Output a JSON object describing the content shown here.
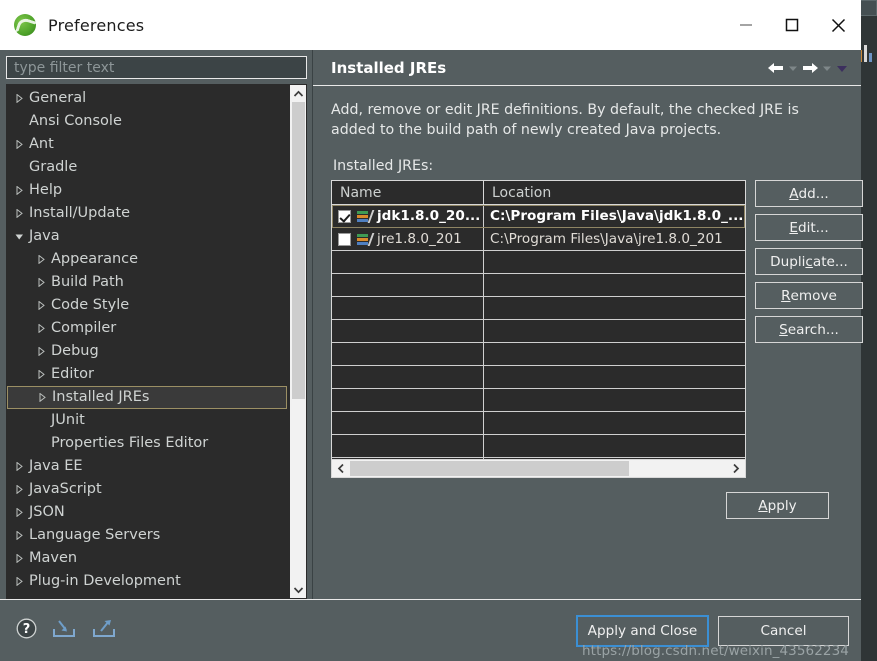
{
  "window": {
    "title": "Preferences",
    "app_icon": "eclipse-logo-icon",
    "controls": {
      "minimize": "minimize-icon",
      "maximize": "maximize-icon",
      "close": "close-icon"
    }
  },
  "sidebar": {
    "filter": {
      "placeholder": "type filter text",
      "value": ""
    },
    "items": [
      {
        "label": "General",
        "level": 1,
        "arrow": "collapsed"
      },
      {
        "label": "Ansi Console",
        "level": 1,
        "arrow": "none"
      },
      {
        "label": "Ant",
        "level": 1,
        "arrow": "collapsed"
      },
      {
        "label": "Gradle",
        "level": 1,
        "arrow": "none"
      },
      {
        "label": "Help",
        "level": 1,
        "arrow": "collapsed"
      },
      {
        "label": "Install/Update",
        "level": 1,
        "arrow": "collapsed"
      },
      {
        "label": "Java",
        "level": 1,
        "arrow": "expanded"
      },
      {
        "label": "Appearance",
        "level": 2,
        "arrow": "collapsed"
      },
      {
        "label": "Build Path",
        "level": 2,
        "arrow": "collapsed"
      },
      {
        "label": "Code Style",
        "level": 2,
        "arrow": "collapsed"
      },
      {
        "label": "Compiler",
        "level": 2,
        "arrow": "collapsed"
      },
      {
        "label": "Debug",
        "level": 2,
        "arrow": "collapsed"
      },
      {
        "label": "Editor",
        "level": 2,
        "arrow": "collapsed"
      },
      {
        "label": "Installed JREs",
        "level": 2,
        "arrow": "collapsed",
        "selected": true
      },
      {
        "label": "JUnit",
        "level": 2,
        "arrow": "none"
      },
      {
        "label": "Properties Files Editor",
        "level": 2,
        "arrow": "none"
      },
      {
        "label": "Java EE",
        "level": 1,
        "arrow": "collapsed"
      },
      {
        "label": "JavaScript",
        "level": 1,
        "arrow": "collapsed"
      },
      {
        "label": "JSON",
        "level": 1,
        "arrow": "collapsed"
      },
      {
        "label": "Language Servers",
        "level": 1,
        "arrow": "collapsed"
      },
      {
        "label": "Maven",
        "level": 1,
        "arrow": "collapsed"
      },
      {
        "label": "Plug-in Development",
        "level": 1,
        "arrow": "collapsed"
      }
    ]
  },
  "panel": {
    "title": "Installed JREs",
    "nav": {
      "back": "back-arrow-icon",
      "forward": "forward-arrow-icon",
      "menu": "chevron-down-icon"
    },
    "description": "Add, remove or edit JRE definitions. By default, the checked JRE is added to the build path of newly created Java projects.",
    "list_label": "Installed JREs:",
    "table": {
      "columns": [
        "Name",
        "Location"
      ],
      "rows": [
        {
          "checked": true,
          "selected": true,
          "name": "jdk1.8.0_20...",
          "location": "C:\\Program Files\\Java\\jdk1.8.0_..."
        },
        {
          "checked": false,
          "selected": false,
          "name": "jre1.8.0_201",
          "location": "C:\\Program Files\\Java\\jre1.8.0_201"
        }
      ],
      "empty_row_count": 10
    },
    "buttons": [
      {
        "label": "Add...",
        "mnemonic": "A"
      },
      {
        "label": "Edit...",
        "mnemonic": "E"
      },
      {
        "label": "Duplicate...",
        "mnemonic": "c"
      },
      {
        "label": "Remove",
        "mnemonic": "R"
      },
      {
        "label": "Search...",
        "mnemonic": "S"
      }
    ],
    "apply": {
      "label": "Apply",
      "mnemonic": "A"
    }
  },
  "footer": {
    "icons": [
      {
        "name": "help-icon"
      },
      {
        "name": "import-icon"
      },
      {
        "name": "export-icon"
      }
    ],
    "apply_and_close": "Apply and Close",
    "cancel": "Cancel",
    "watermark": "https://blog.csdn.net/weixin_43562234"
  },
  "colors": {
    "dialog_bg": "#555e60",
    "tree_bg": "#2b2b2b",
    "titlebar_bg": "#ffffff",
    "focus_blue": "#3b8fd4",
    "selection_border": "#9b8f64"
  }
}
